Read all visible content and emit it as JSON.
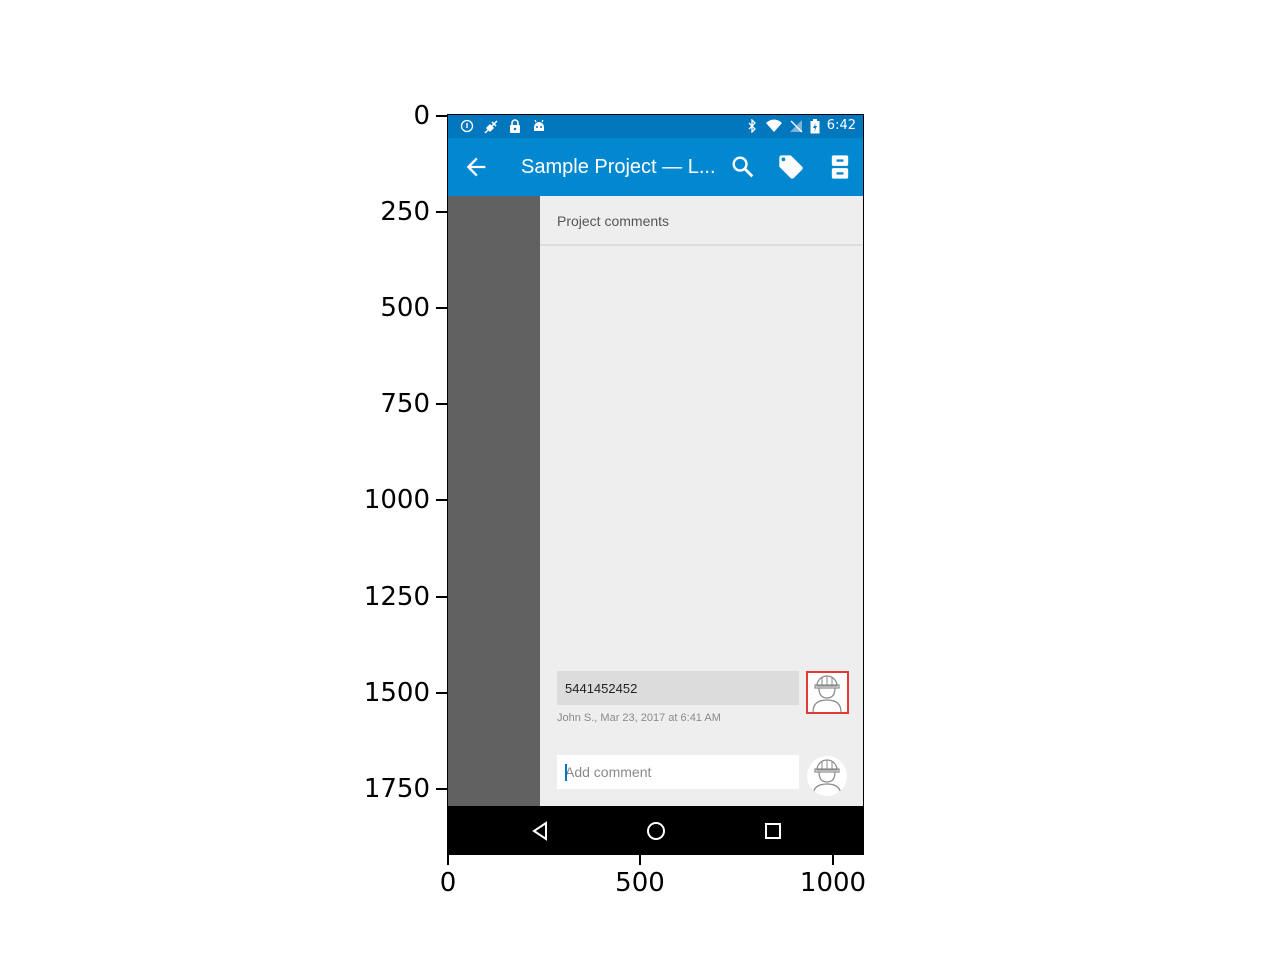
{
  "axes": {
    "y_ticks": [
      "0",
      "250",
      "500",
      "750",
      "1000",
      "1250",
      "1500",
      "1750"
    ],
    "x_ticks": [
      "0",
      "500",
      "1000"
    ]
  },
  "status_bar": {
    "time": "6:42",
    "left_icons": [
      "info-icon",
      "satellite-off-icon",
      "lock-icon",
      "android-icon"
    ],
    "right_icons": [
      "bluetooth-icon",
      "wifi-icon",
      "no-signal-icon",
      "battery-charging-icon"
    ]
  },
  "app_bar": {
    "title": "Sample Project — L...",
    "actions": [
      "search-icon",
      "tag-icon",
      "storage-icon"
    ],
    "color": "#0288d1"
  },
  "panel": {
    "title": "Project comments"
  },
  "comments": [
    {
      "text": "5441452452",
      "meta": "John S., Mar 23, 2017 at 6:41 AM"
    }
  ],
  "composer": {
    "placeholder": "Add comment",
    "value": ""
  },
  "navigation": [
    "back-icon",
    "home-icon",
    "recents-icon"
  ],
  "highlight_color": "#e53935"
}
